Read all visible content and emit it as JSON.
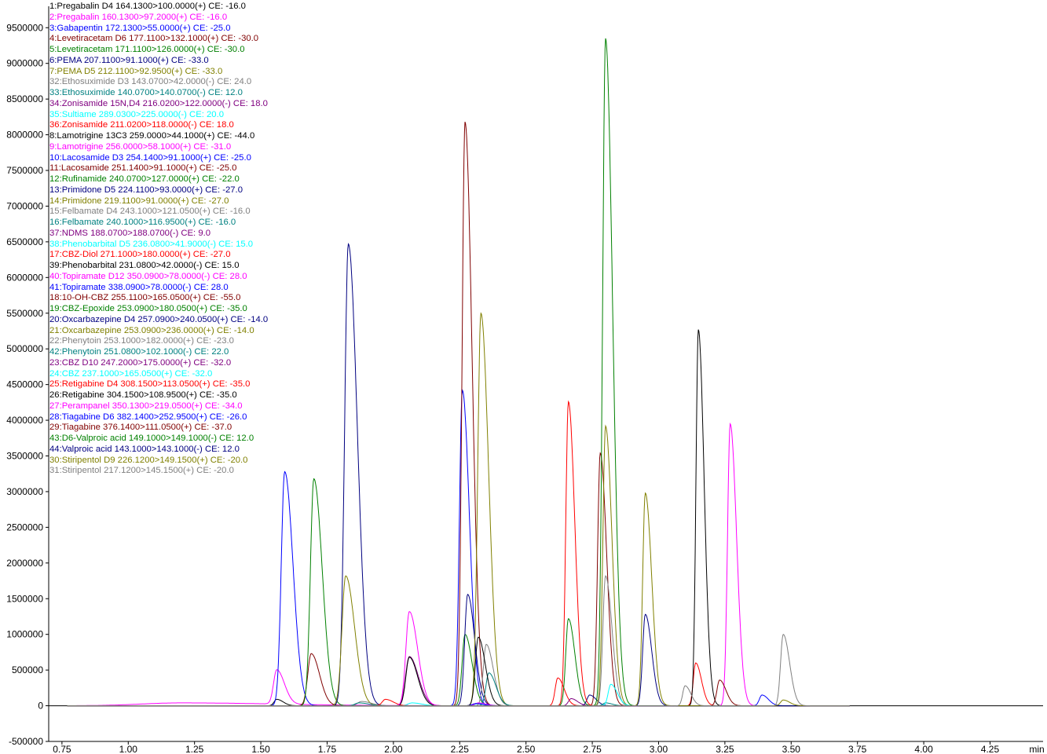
{
  "chart_data": {
    "type": "line",
    "title": "",
    "xlabel": "min",
    "ylabel": "",
    "xlim": [
      0.7,
      4.45
    ],
    "ylim": [
      -500000,
      9800000
    ],
    "grid": false,
    "legend_placement": "top-left",
    "x_ticks": [
      "0.75",
      "1.00",
      "1.25",
      "1.50",
      "1.75",
      "2.00",
      "2.25",
      "2.50",
      "2.75",
      "3.00",
      "3.25",
      "3.50",
      "3.75",
      "4.00",
      "4.25",
      "min"
    ],
    "y_ticks": [
      "9500000",
      "9000000",
      "8500000",
      "8000000",
      "7500000",
      "7000000",
      "6500000",
      "6000000",
      "5500000",
      "5000000",
      "4500000",
      "4000000",
      "3500000",
      "3000000",
      "2500000",
      "2000000",
      "1500000",
      "1000000",
      "500000",
      "0",
      "-500000"
    ],
    "y_tick_values": [
      9500000,
      9000000,
      8500000,
      8000000,
      7500000,
      7000000,
      6500000,
      6000000,
      5500000,
      5000000,
      4500000,
      4000000,
      3500000,
      3000000,
      2500000,
      2000000,
      1500000,
      1000000,
      500000,
      0,
      -500000
    ],
    "x_tick_values": [
      0.75,
      1.0,
      1.25,
      1.5,
      1.75,
      2.0,
      2.25,
      2.5,
      2.75,
      3.0,
      3.25,
      3.5,
      3.75,
      4.0,
      4.25
    ],
    "series": [
      {
        "name": "1:Pregabalin D4 164.1300>100.0000(+) CE: -16.0",
        "color": "#000000",
        "peaks": [
          [
            1.56,
            90000,
            0.01
          ]
        ]
      },
      {
        "name": "2:Pregabalin 160.1300>97.2000(+) CE: -16.0",
        "color": "#ff00ff",
        "peaks": [
          [
            1.56,
            480000,
            0.012
          ],
          [
            1.2,
            40000,
            0.15
          ]
        ]
      },
      {
        "name": "3:Gabapentin 172.1300>55.0000(+) CE: -25.0",
        "color": "#0000ff",
        "peaks": [
          [
            1.59,
            3280000,
            0.013
          ]
        ]
      },
      {
        "name": "4:Levetiracetam D6 177.1100>132.1000(+) CE: -30.0",
        "color": "#800000",
        "peaks": [
          [
            1.69,
            730000,
            0.013
          ]
        ]
      },
      {
        "name": "5:Levetiracetam 171.1100>126.0000(+) CE: -30.0",
        "color": "#008000",
        "peaks": [
          [
            1.7,
            3180000,
            0.013
          ]
        ]
      },
      {
        "name": "6:PEMA 207.1100>91.1000(+) CE: -33.0",
        "color": "#000080",
        "peaks": [
          [
            1.83,
            6470000,
            0.014
          ]
        ]
      },
      {
        "name": "7:PEMA D5 212.1100>92.9500(+) CE: -33.0",
        "color": "#808000",
        "peaks": [
          [
            1.82,
            1820000,
            0.014
          ]
        ]
      },
      {
        "name": "32:Ethosuximide D3 143.0700>42.0000(-) CE: 24.0",
        "color": "#808080",
        "peaks": [
          [
            1.88,
            60000,
            0.015
          ]
        ]
      },
      {
        "name": "33:Ethosuximide 140.0700>140.0700(-) CE: 12.0",
        "color": "#008080",
        "peaks": [
          [
            1.87,
            40000,
            0.015
          ]
        ]
      },
      {
        "name": "34:Zonisamide 15N,D4 216.0200>122.0000(-) CE: 18.0",
        "color": "#800080",
        "peaks": [
          [
            2.06,
            690000,
            0.014
          ]
        ]
      },
      {
        "name": "35:Sultiame 289.0300>225.0000(-) CE: 20.0",
        "color": "#00ffff",
        "peaks": [
          [
            2.07,
            40000,
            0.015
          ]
        ]
      },
      {
        "name": "36:Zonisamide 211.0200>118.0000(-) CE: 18.0",
        "color": "#ff0000",
        "peaks": [
          [
            1.97,
            90000,
            0.012
          ]
        ]
      },
      {
        "name": "8:Lamotrigine 13C3 259.0000>44.1000(+) CE: -44.0",
        "color": "#000000",
        "peaks": [
          [
            2.06,
            680000,
            0.013
          ]
        ]
      },
      {
        "name": "9:Lamotrigine 256.0000>58.1000(+) CE: -31.0",
        "color": "#ff00ff",
        "peaks": [
          [
            2.06,
            1320000,
            0.013
          ]
        ]
      },
      {
        "name": "10:Lacosamide D3 254.1400>91.1000(+) CE: -25.0",
        "color": "#0000ff",
        "peaks": [
          [
            2.26,
            4420000,
            0.011
          ]
        ]
      },
      {
        "name": "11:Lacosamide 251.1400>91.1000(+) CE: -25.0",
        "color": "#800000",
        "peaks": [
          [
            2.27,
            8180000,
            0.011
          ]
        ]
      },
      {
        "name": "12:Rufinamide 240.0700>127.0000(+) CE: -22.0",
        "color": "#008000",
        "peaks": [
          [
            2.27,
            1000000,
            0.011
          ]
        ]
      },
      {
        "name": "13:Primidone D5 224.1100>93.0000(+) CE: -27.0",
        "color": "#000080",
        "peaks": [
          [
            2.28,
            1560000,
            0.011
          ]
        ]
      },
      {
        "name": "14:Primidone 219.1100>91.0000(+) CE: -27.0",
        "color": "#808000",
        "peaks": [
          [
            2.33,
            5500000,
            0.012
          ]
        ]
      },
      {
        "name": "15:Felbamate D4 243.1000>121.0500(+) CE: -16.0",
        "color": "#808080",
        "peaks": [
          [
            2.35,
            860000,
            0.011
          ]
        ]
      },
      {
        "name": "16:Felbamate 240.1000>116.9500(+) CE: -16.0",
        "color": "#008080",
        "peaks": [
          [
            2.36,
            460000,
            0.011
          ]
        ]
      },
      {
        "name": "37:NDMS 188.0700>188.0700(-) CE: 9.0",
        "color": "#800080",
        "peaks": [
          [
            2.31,
            30000,
            0.012
          ]
        ]
      },
      {
        "name": "38:Phenobarbital D5 236.0800>41.9000(-) CE: 15.0",
        "color": "#00ffff",
        "peaks": [
          [
            2.32,
            30000,
            0.012
          ]
        ]
      },
      {
        "name": "17:CBZ-Diol 271.1000>180.0000(+) CE: -27.0",
        "color": "#ff0000",
        "peaks": [
          [
            2.62,
            390000,
            0.01
          ]
        ]
      },
      {
        "name": "39:Phenobarbital 231.0800>42.0000(-) CE: 15.0",
        "color": "#000000",
        "peaks": [
          [
            2.32,
            960000,
            0.011
          ]
        ]
      },
      {
        "name": "40:Topiramate D12 350.0900>78.0000(-) CE: 28.0",
        "color": "#ff00ff",
        "peaks": [
          [
            2.32,
            40000,
            0.012
          ]
        ]
      },
      {
        "name": "41:Topiramate 338.0900>78.0000(-) CE: 28.0",
        "color": "#0000ff",
        "peaks": [
          [
            2.31,
            30000,
            0.012
          ]
        ]
      },
      {
        "name": "18:10-OH-CBZ 255.1100>165.0500(+) CE: -55.0",
        "color": "#800000",
        "peaks": [
          [
            2.78,
            3540000,
            0.01
          ]
        ]
      },
      {
        "name": "19:CBZ-Epoxide 253.0900>180.0500(+) CE: -35.0",
        "color": "#008000",
        "peaks": [
          [
            2.66,
            1220000,
            0.01
          ]
        ]
      },
      {
        "name": "20:Oxcarbazepine D4 257.0900>240.0500(+) CE: -14.0",
        "color": "#000080",
        "peaks": [
          [
            2.74,
            150000,
            0.01
          ]
        ]
      },
      {
        "name": "21:Oxcarbazepine 253.0900>236.0000(+) CE: -14.0",
        "color": "#808000",
        "peaks": [
          [
            2.8,
            3920000,
            0.01
          ]
        ]
      },
      {
        "name": "22:Phenytoin 253.1000>182.0000(+) CE: -23.0",
        "color": "#808080",
        "peaks": [
          [
            2.8,
            1820000,
            0.01
          ]
        ]
      },
      {
        "name": "42:Phenytoin 251.0800>102.1000(-) CE: 22.0",
        "color": "#008080",
        "peaks": [
          [
            2.8,
            40000,
            0.01
          ]
        ]
      },
      {
        "name": "23:CBZ D10 247.2000>175.0000(+) CE: -32.0",
        "color": "#800080",
        "peaks": [
          [
            2.67,
            100000,
            0.01
          ]
        ]
      },
      {
        "name": "24:CBZ 237.1000>165.0500(+) CE: -32.0",
        "color": "#00ffff",
        "peaks": [
          [
            2.82,
            300000,
            0.01
          ]
        ]
      },
      {
        "name": "25:Retigabine D4 308.1500>113.0500(+) CE: -35.0",
        "color": "#ff0000",
        "peaks": [
          [
            2.66,
            4260000,
            0.01
          ],
          [
            3.14,
            600000,
            0.009
          ]
        ]
      },
      {
        "name": "26:Retigabine 304.1500>108.9500(+) CE: -35.0",
        "color": "#000000",
        "peaks": [
          [
            3.15,
            5270000,
            0.009
          ]
        ]
      },
      {
        "name": "27:Perampanel 350.1300>219.0500(+) CE: -34.0",
        "color": "#ff00ff",
        "peaks": [
          [
            3.27,
            3950000,
            0.01
          ]
        ]
      },
      {
        "name": "28:Tiagabine D6 382.1400>252.9500(+) CE: -26.0",
        "color": "#0000ff",
        "peaks": [
          [
            3.39,
            150000,
            0.01
          ]
        ]
      },
      {
        "name": "29:Tiagabine 376.1400>111.0500(+) CE: -37.0",
        "color": "#800000",
        "peaks": [
          [
            3.23,
            360000,
            0.01
          ]
        ]
      },
      {
        "name": "43:D6-Valproic acid 149.1000>149.1000(-) CE: 12.0",
        "color": "#008000",
        "peaks": [
          [
            2.8,
            9350000,
            0.011
          ]
        ]
      },
      {
        "name": "44:Valproic acid 143.1000>143.1000(-) CE: 12.0",
        "color": "#000080",
        "peaks": [
          [
            2.95,
            1280000,
            0.01
          ]
        ]
      },
      {
        "name": "30:Stiripentol D9 226.1200>149.1500(+) CE: -20.0",
        "color": "#808000",
        "peaks": [
          [
            2.95,
            2980000,
            0.01
          ],
          [
            3.47,
            80000,
            0.01
          ]
        ]
      },
      {
        "name": "31:Stiripentol 217.1200>145.1500(+) CE: -20.0",
        "color": "#808080",
        "peaks": [
          [
            3.47,
            1000000,
            0.01
          ],
          [
            3.1,
            280000,
            0.009
          ]
        ]
      }
    ]
  }
}
